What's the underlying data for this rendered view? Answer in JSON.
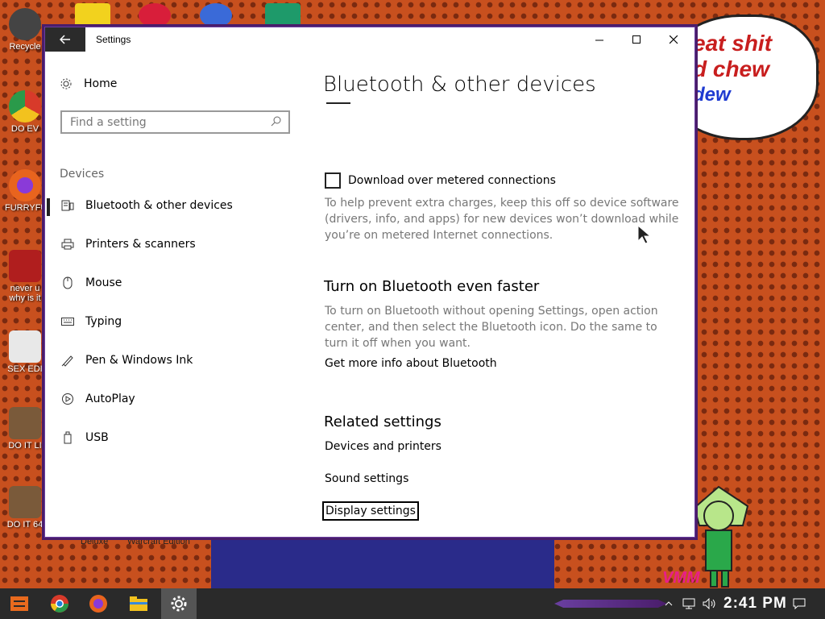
{
  "desktop": {
    "icons": [
      {
        "label": "Recycle",
        "color": "#444444"
      },
      {
        "label": "DO EV",
        "color": "#1e7fd6"
      },
      {
        "label": "FURRYFU",
        "color": "#e8641e"
      },
      {
        "label": "never u why is it",
        "color": "#b01e1e"
      },
      {
        "label": "SEX EDI",
        "color": "#e8e8e8"
      },
      {
        "label": "DO IT LI",
        "color": "#7a5a3a"
      },
      {
        "label": "DO IT 64",
        "color": "#7a5a3a"
      }
    ],
    "bubble_lines": [
      "eat shit",
      "d chew",
      "dew"
    ],
    "bottom_labels": [
      "Deluxe",
      "Warcraft Edition"
    ],
    "corner_label": "VMM"
  },
  "window": {
    "title": "Settings",
    "back_icon": "arrow-left-icon",
    "minimize_icon": "minimize-icon",
    "maximize_icon": "maximize-icon",
    "close_icon": "close-icon"
  },
  "nav": {
    "home_label": "Home",
    "search_placeholder": "Find a setting",
    "section_label": "Devices",
    "items": [
      {
        "label": "Bluetooth & other devices",
        "icon": "bluetooth-devices-icon",
        "selected": true
      },
      {
        "label": "Printers & scanners",
        "icon": "printer-icon",
        "selected": false
      },
      {
        "label": "Mouse",
        "icon": "mouse-icon",
        "selected": false
      },
      {
        "label": "Typing",
        "icon": "keyboard-icon",
        "selected": false
      },
      {
        "label": "Pen & Windows Ink",
        "icon": "pen-icon",
        "selected": false
      },
      {
        "label": "AutoPlay",
        "icon": "autoplay-icon",
        "selected": false
      },
      {
        "label": "USB",
        "icon": "usb-icon",
        "selected": false
      }
    ]
  },
  "content": {
    "page_title": "Bluetooth & other devices",
    "metered": {
      "label": "Download over metered connections",
      "checked": false,
      "description": "To help prevent extra charges, keep this off so device software (drivers, info, and apps) for new devices won’t download while you’re on metered Internet connections."
    },
    "faster": {
      "heading": "Turn on Bluetooth even faster",
      "description": "To turn on Bluetooth without opening Settings, open action center, and then select the Bluetooth icon. Do the same to turn it off when you want.",
      "link": "Get more info about Bluetooth"
    },
    "related": {
      "heading": "Related settings",
      "links": [
        "Devices and printers",
        "Sound settings",
        "Display settings"
      ]
    }
  },
  "taskbar": {
    "items": [
      "start-icon",
      "chrome-icon",
      "firefox-icon",
      "file-explorer-icon",
      "settings-icon"
    ],
    "tray_icons": [
      "chevron-up-icon",
      "network-icon",
      "volume-icon"
    ],
    "clock": "2:41 PM",
    "notification_icon": "action-center-icon"
  },
  "colors": {
    "accent": "#000000",
    "desktop_bg": "#c8501e",
    "taskbar_bg": "#2a2a2a",
    "window_border": "#4a1d6b"
  }
}
